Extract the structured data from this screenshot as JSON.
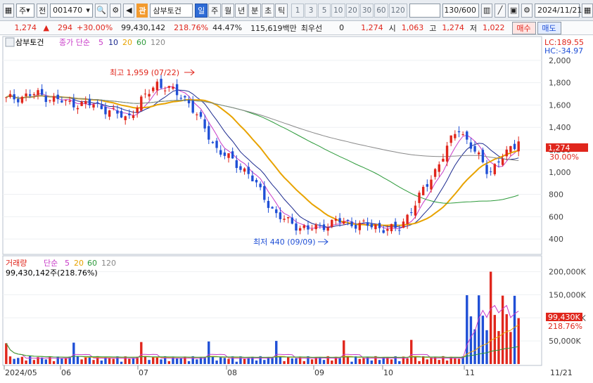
{
  "toolbar": {
    "market": "주",
    "view": "전",
    "code": "001470",
    "badge": "관",
    "name": "삼부토건",
    "periods": [
      "일",
      "주",
      "월",
      "년",
      "분",
      "초",
      "틱"
    ],
    "active_period": "일",
    "nums": [
      "1",
      "3",
      "5",
      "10",
      "20",
      "30",
      "60",
      "120"
    ],
    "count": "130",
    "count_total": "/600",
    "date": "2024/11/21"
  },
  "info": {
    "price": "1,274",
    "change": "294",
    "change_pct": "+30.00%",
    "volume": "99,430,142",
    "volume_ratio": "218.76%",
    "turnover_pct": "44.47%",
    "amount": "115,619백만",
    "pref_label": "최우선",
    "pref_value": "0",
    "current": "1,274",
    "open_label": "시",
    "open": "1,063",
    "high_label": "고",
    "high": "1,274",
    "low_label": "저",
    "low": "1,022",
    "buy": "매수",
    "sell": "매도"
  },
  "price_panel": {
    "legend_name": "삼부토건",
    "legend_ma": "종가 단순",
    "ma_periods": [
      "5",
      "10",
      "20",
      "60",
      "120"
    ],
    "lc": "LC:189.55",
    "hc": "HC:-34.97",
    "y_ticks": [
      "2,000",
      "1,800",
      "1,600",
      "1,400",
      "1,200",
      "1,000",
      "800",
      "600",
      "400"
    ],
    "last_price_label": "1,274",
    "last_pct_label": "30.00%",
    "high_annotation": "최고 1,959 (07/22)",
    "low_annotation": "최저 440 (09/09)"
  },
  "volume_panel": {
    "legend_name": "거래량",
    "legend_ma": "단순",
    "ma_periods": [
      "5",
      "20",
      "60",
      "120"
    ],
    "info_text": "99,430,142주(218.76%)",
    "y_ticks": [
      "200,000K",
      "150,000K",
      "100,000K",
      "50,000K"
    ],
    "last_vol_label": "99,430K",
    "last_pct_label": "218.76%"
  },
  "x_axis": {
    "labels": [
      "2024/05",
      "06",
      "07",
      "08",
      "09",
      "10",
      "11"
    ],
    "right_label": "11/21"
  },
  "colors": {
    "up": "#e0261c",
    "down": "#1f4fd6",
    "ma5": "#c83cc8",
    "ma10": "#1c2a8f",
    "ma20": "#e8a300",
    "ma60": "#2c9a3a",
    "ma120": "#888888"
  },
  "chart_data": {
    "type": "candlestick",
    "price_range": [
      300,
      2100
    ],
    "volume_range": [
      0,
      210000
    ],
    "close_keypoints": [
      {
        "x": "2024/05",
        "y": 1650
      },
      {
        "x": "05/mid",
        "y": 1700
      },
      {
        "x": "06",
        "y": 1620
      },
      {
        "x": "06/mid",
        "y": 1600
      },
      {
        "x": "07",
        "y": 1480
      },
      {
        "x": "07/22",
        "y": 1800
      },
      {
        "x": "07/end",
        "y": 1650
      },
      {
        "x": "08/05",
        "y": 1200
      },
      {
        "x": "08/15",
        "y": 1000
      },
      {
        "x": "08/end",
        "y": 600
      },
      {
        "x": "09/09",
        "y": 480
      },
      {
        "x": "09/end",
        "y": 560
      },
      {
        "x": "10",
        "y": 520
      },
      {
        "x": "10/end",
        "y": 480
      },
      {
        "x": "11/05",
        "y": 900
      },
      {
        "x": "11/10",
        "y": 1400
      },
      {
        "x": "11/18",
        "y": 1000
      },
      {
        "x": "11/21",
        "y": 1274
      }
    ]
  }
}
